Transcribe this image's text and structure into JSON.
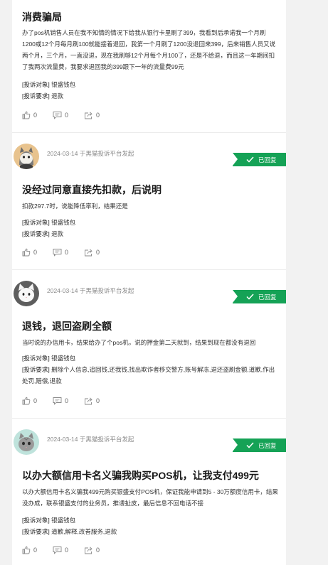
{
  "complaints": [
    {
      "title": "消费骗局",
      "content": "办了pos机销售人员在我不知情的情况下给我从银行卡里刷了399，我看到后承诺我一个月刷1200或12个月每月刷100就能接着退回，我第一个月刷了1200没退回来399，后来销售人员又说两个月，三个月，一直没退，现在我刷够12个月每个月100了，还是不给退，而且这一年期间扣了我两次流量费，我要求退回我的399跟下一年的流量费99元",
      "target_label": "[投诉对象]",
      "target": "银盛钱包",
      "demand_label": "[投诉要求]",
      "demand": "退款",
      "likes": "0",
      "comments": "0",
      "shares": "0"
    },
    {
      "meta": "2024-03-14 于黑猫投诉平台发起",
      "status": "已回复",
      "title": "没经过同意直接先扣款，后说明",
      "content": "扣款297.7时，说能降低率利，结果还是",
      "target_label": "[投诉对象]",
      "target": "银盛钱包",
      "demand_label": "[投诉要求]",
      "demand": "退款",
      "likes": "0",
      "comments": "0",
      "shares": "0"
    },
    {
      "meta": "2024-03-14 于黑猫投诉平台发起",
      "status": "已回复",
      "title": "退钱，退回盗刷全额",
      "content": "当时说的办信用卡，结果给办了个pos机，说的押金第二天就到，结果到现在都没有退回",
      "target_label": "[投诉对象]",
      "target": "银盛钱包",
      "demand_label": "[投诉要求]",
      "demand": "删除个人信息,追回钱,还我钱,找出欺诈者移交警方,账号解冻,退还盗刷金额,道歉,作出处罚,赔偿,退款",
      "likes": "0",
      "comments": "0",
      "shares": "0"
    },
    {
      "meta": "2024-03-14 于黑猫投诉平台发起",
      "status": "已回复",
      "title": "以办大额信用卡名义骗我购买POS机，让我支付499元",
      "content": "以办大额信用卡名义骗我499元购买银盛支付POS机，保证我能申请到5 - 30万额度信用卡，结果没办成，联系银盛支付的业务员，推诿扯皮，最后信息不回电话不接",
      "target_label": "[投诉对象]",
      "target": "银盛钱包",
      "demand_label": "[投诉要求]",
      "demand": "道歉,解释,改善服务,退款",
      "likes": "0",
      "comments": "0",
      "shares": "0"
    }
  ],
  "icons": {
    "like": "thumbs-up-icon",
    "comment": "comment-icon",
    "share": "share-icon",
    "check": "check-icon"
  },
  "colors": {
    "badge": "#15a256",
    "background": "#f2f2f2"
  }
}
